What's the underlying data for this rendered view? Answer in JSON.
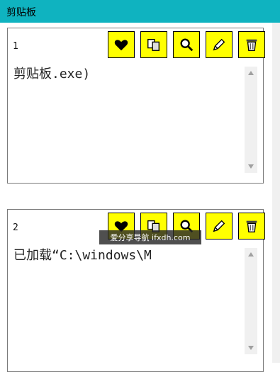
{
  "window": {
    "title": "剪贴板"
  },
  "entries": [
    {
      "index": "1",
      "text": "剪贴板.exe)"
    },
    {
      "index": "2",
      "text": "已加载“C:\\windows\\M"
    }
  ],
  "toolbar": {
    "favorite_icon": "heart-icon",
    "copy_icon": "copy-icon",
    "search_icon": "magnifier-icon",
    "edit_icon": "pencil-icon",
    "delete_icon": "trash-icon"
  },
  "watermark": {
    "text": "爱分享导航 ifxdh.com"
  },
  "colors": {
    "titlebar": "#0fb3c0",
    "button": "#ffff00"
  }
}
